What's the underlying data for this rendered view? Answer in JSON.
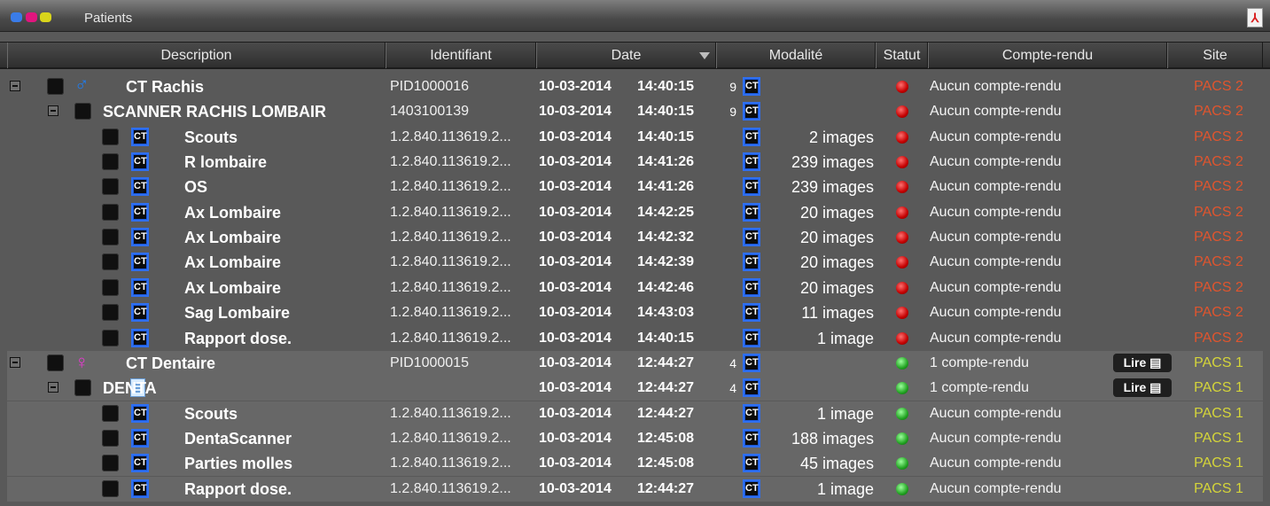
{
  "window": {
    "title": "Patients",
    "icons": [
      "logo-icon",
      "pdf-icon"
    ],
    "logo_colors": [
      "#3a7ce8",
      "#e0157e",
      "#d9d51b"
    ]
  },
  "columns": [
    {
      "key": "description",
      "label": "Description"
    },
    {
      "key": "identifiant",
      "label": "Identifiant"
    },
    {
      "key": "date",
      "label": "Date",
      "sorted": "desc"
    },
    {
      "key": "modalite",
      "label": "Modalité"
    },
    {
      "key": "statut",
      "label": "Statut"
    },
    {
      "key": "compte_rendu",
      "label": "Compte-rendu"
    },
    {
      "key": "site",
      "label": "Site"
    }
  ],
  "colors": {
    "status_red": "#c40000",
    "status_green": "#22a322",
    "site_pacs2": "#e0552e",
    "site_pacs1": "#d5d53a",
    "ct_badge": "#1a58d8"
  },
  "rows": [
    {
      "level": 0,
      "icon": "male-icon",
      "description": "CT Rachis",
      "identifiant": "PID1000016",
      "date": "10-03-2014",
      "time": "14:40:15",
      "series_count": "9",
      "modality": "CT",
      "images": "",
      "status": "red",
      "report": "Aucun compte-rendu",
      "read": "",
      "site": "PACS 2"
    },
    {
      "level": 1,
      "icon": "",
      "description": "SCANNER RACHIS LOMBAIR",
      "identifiant": "1403100139",
      "date": "10-03-2014",
      "time": "14:40:15",
      "series_count": "9",
      "modality": "CT",
      "images": "",
      "status": "red",
      "report": "Aucun compte-rendu",
      "read": "",
      "site": "PACS 2"
    },
    {
      "level": 2,
      "icon": "ct",
      "description": "Scouts",
      "identifiant": "1.2.840.113619.2...",
      "date": "10-03-2014",
      "time": "14:40:15",
      "series_count": "",
      "modality": "CT",
      "images": "2 images",
      "status": "red",
      "report": "Aucun compte-rendu",
      "read": "",
      "site": "PACS 2"
    },
    {
      "level": 2,
      "icon": "ct",
      "description": "R lombaire",
      "identifiant": "1.2.840.113619.2...",
      "date": "10-03-2014",
      "time": "14:41:26",
      "series_count": "",
      "modality": "CT",
      "images": "239 images",
      "status": "red",
      "report": "Aucun compte-rendu",
      "read": "",
      "site": "PACS 2"
    },
    {
      "level": 2,
      "icon": "ct",
      "description": "OS",
      "identifiant": "1.2.840.113619.2...",
      "date": "10-03-2014",
      "time": "14:41:26",
      "series_count": "",
      "modality": "CT",
      "images": "239 images",
      "status": "red",
      "report": "Aucun compte-rendu",
      "read": "",
      "site": "PACS 2"
    },
    {
      "level": 2,
      "icon": "ct",
      "description": "Ax Lombaire",
      "identifiant": "1.2.840.113619.2...",
      "date": "10-03-2014",
      "time": "14:42:25",
      "series_count": "",
      "modality": "CT",
      "images": "20 images",
      "status": "red",
      "report": "Aucun compte-rendu",
      "read": "",
      "site": "PACS 2"
    },
    {
      "level": 2,
      "icon": "ct",
      "description": "Ax Lombaire",
      "identifiant": "1.2.840.113619.2...",
      "date": "10-03-2014",
      "time": "14:42:32",
      "series_count": "",
      "modality": "CT",
      "images": "20 images",
      "status": "red",
      "report": "Aucun compte-rendu",
      "read": "",
      "site": "PACS 2"
    },
    {
      "level": 2,
      "icon": "ct",
      "description": "Ax Lombaire",
      "identifiant": "1.2.840.113619.2...",
      "date": "10-03-2014",
      "time": "14:42:39",
      "series_count": "",
      "modality": "CT",
      "images": "20 images",
      "status": "red",
      "report": "Aucun compte-rendu",
      "read": "",
      "site": "PACS 2"
    },
    {
      "level": 2,
      "icon": "ct",
      "description": "Ax Lombaire",
      "identifiant": "1.2.840.113619.2...",
      "date": "10-03-2014",
      "time": "14:42:46",
      "series_count": "",
      "modality": "CT",
      "images": "20 images",
      "status": "red",
      "report": "Aucun compte-rendu",
      "read": "",
      "site": "PACS 2"
    },
    {
      "level": 2,
      "icon": "ct",
      "description": "Sag Lombaire",
      "identifiant": "1.2.840.113619.2...",
      "date": "10-03-2014",
      "time": "14:43:03",
      "series_count": "",
      "modality": "CT",
      "images": "11 images",
      "status": "red",
      "report": "Aucun compte-rendu",
      "read": "",
      "site": "PACS 2"
    },
    {
      "level": 2,
      "icon": "ct",
      "description": "Rapport dose.",
      "identifiant": "1.2.840.113619.2...",
      "date": "10-03-2014",
      "time": "14:40:15",
      "series_count": "",
      "modality": "CT",
      "images": "1 image",
      "status": "red",
      "report": "Aucun compte-rendu",
      "read": "",
      "site": "PACS 2"
    },
    {
      "level": 0,
      "icon": "female-icon",
      "description": "CT Dentaire",
      "identifiant": "PID1000015",
      "date": "10-03-2014",
      "time": "12:44:27",
      "series_count": "4",
      "modality": "CT",
      "images": "",
      "status": "green",
      "report": "1 compte-rendu",
      "read": "Lire ▤",
      "site": "PACS 1"
    },
    {
      "level": 1,
      "icon": "document-icon",
      "description": "DENTA",
      "identifiant": "",
      "date": "10-03-2014",
      "time": "12:44:27",
      "series_count": "4",
      "modality": "CT",
      "images": "",
      "status": "green",
      "report": "1 compte-rendu",
      "read": "Lire ▤",
      "site": "PACS 1"
    },
    {
      "level": 2,
      "icon": "ct",
      "description": "Scouts",
      "identifiant": "1.2.840.113619.2...",
      "date": "10-03-2014",
      "time": "12:44:27",
      "series_count": "",
      "modality": "CT",
      "images": "1 image",
      "status": "green",
      "report": "Aucun compte-rendu",
      "read": "",
      "site": "PACS 1"
    },
    {
      "level": 2,
      "icon": "ct",
      "description": "DentaScanner",
      "identifiant": "1.2.840.113619.2...",
      "date": "10-03-2014",
      "time": "12:45:08",
      "series_count": "",
      "modality": "CT",
      "images": "188 images",
      "status": "green",
      "report": "Aucun compte-rendu",
      "read": "",
      "site": "PACS 1"
    },
    {
      "level": 2,
      "icon": "ct",
      "description": "Parties molles",
      "identifiant": "1.2.840.113619.2...",
      "date": "10-03-2014",
      "time": "12:45:08",
      "series_count": "",
      "modality": "CT",
      "images": "45 images",
      "status": "green",
      "report": "Aucun compte-rendu",
      "read": "",
      "site": "PACS 1"
    },
    {
      "level": 2,
      "icon": "ct",
      "description": "Rapport dose.",
      "identifiant": "1.2.840.113619.2...",
      "date": "10-03-2014",
      "time": "12:44:27",
      "series_count": "",
      "modality": "CT",
      "images": "1 image",
      "status": "green",
      "report": "Aucun compte-rendu",
      "read": "",
      "site": "PACS 1"
    }
  ]
}
